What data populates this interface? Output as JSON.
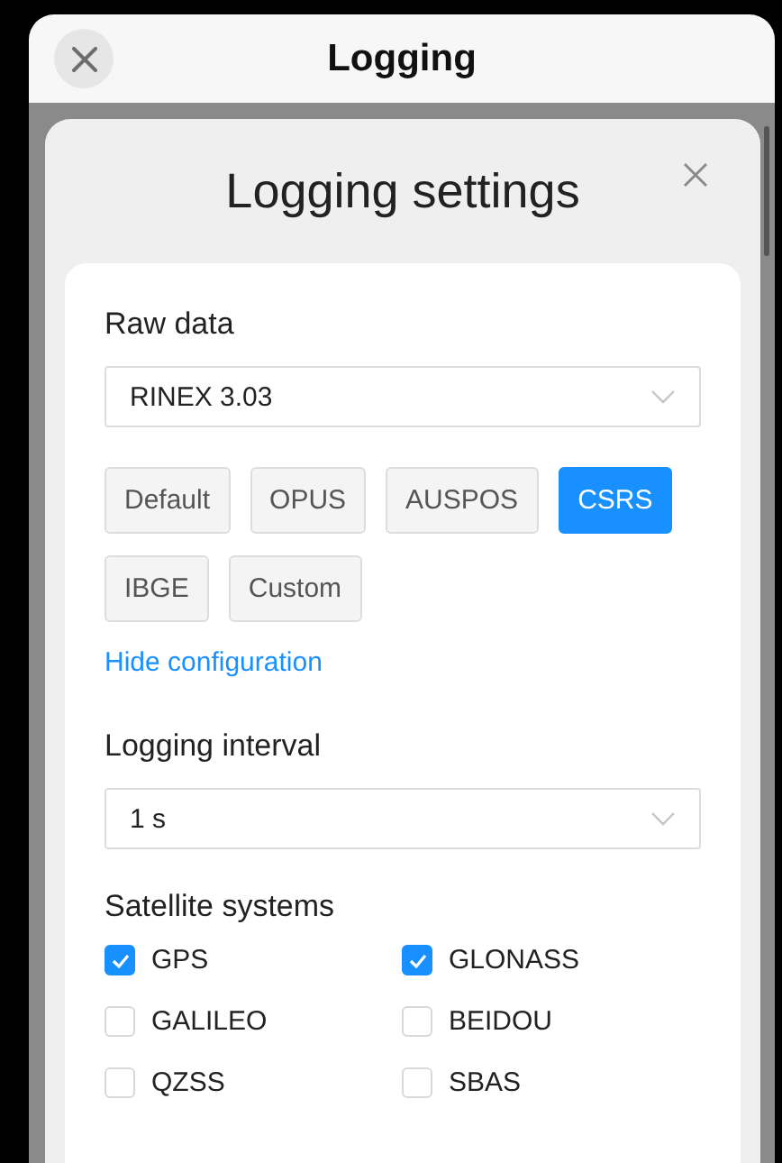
{
  "header": {
    "title": "Logging"
  },
  "dialog": {
    "title": "Logging settings",
    "raw_data": {
      "label": "Raw data",
      "value": "RINEX 3.03",
      "presets": [
        {
          "label": "Default",
          "selected": false
        },
        {
          "label": "OPUS",
          "selected": false
        },
        {
          "label": "AUSPOS",
          "selected": false
        },
        {
          "label": "CSRS",
          "selected": true
        },
        {
          "label": "IBGE",
          "selected": false
        },
        {
          "label": "Custom",
          "selected": false
        }
      ],
      "link": "Hide configuration"
    },
    "logging_interval": {
      "label": "Logging interval",
      "value": "1 s"
    },
    "satellite_systems": {
      "label": "Satellite systems",
      "items": [
        {
          "label": "GPS",
          "checked": true
        },
        {
          "label": "GLONASS",
          "checked": true
        },
        {
          "label": "GALILEO",
          "checked": false
        },
        {
          "label": "BEIDOU",
          "checked": false
        },
        {
          "label": "QZSS",
          "checked": false
        },
        {
          "label": "SBAS",
          "checked": false
        }
      ]
    }
  }
}
